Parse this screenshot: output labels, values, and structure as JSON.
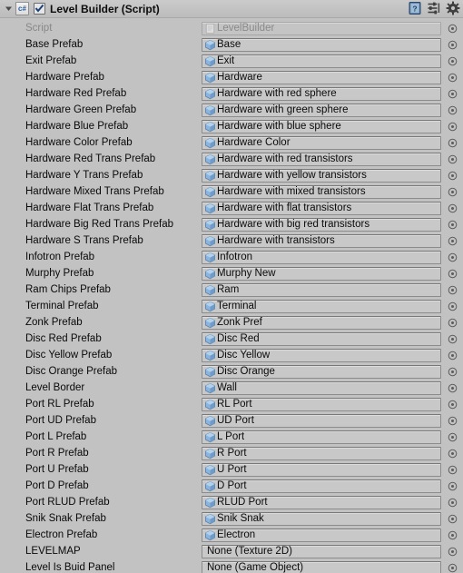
{
  "header": {
    "title": "Level Builder (Script)",
    "script_icon_label": "c#",
    "enabled": true,
    "icons": [
      "help-icon",
      "preset-icon",
      "settings-gear-icon"
    ]
  },
  "colors": {
    "background": "#c2c2c2",
    "field_background": "#c8c8c8",
    "field_border": "#8b8b8b",
    "label_text": "#090909",
    "disabled_text": "#888888",
    "prefab_icon": "#7ba7d7",
    "header_gradient_top": "#cbcbcb"
  },
  "rows": [
    {
      "label": "Script",
      "value": "LevelBuilder",
      "icon": "script-asset-icon",
      "disabled": true
    },
    {
      "label": "Base Prefab",
      "value": "Base",
      "icon": "prefab-icon",
      "disabled": false
    },
    {
      "label": "Exit Prefab",
      "value": "Exit",
      "icon": "prefab-icon",
      "disabled": false
    },
    {
      "label": "Hardware Prefab",
      "value": "Hardware",
      "icon": "prefab-icon",
      "disabled": false
    },
    {
      "label": "Hardware Red Prefab",
      "value": "Hardware with red sphere",
      "icon": "prefab-icon",
      "disabled": false
    },
    {
      "label": "Hardware Green Prefab",
      "value": "Hardware with green sphere",
      "icon": "prefab-icon",
      "disabled": false
    },
    {
      "label": "Hardware Blue Prefab",
      "value": "Hardware with blue sphere",
      "icon": "prefab-icon",
      "disabled": false
    },
    {
      "label": "Hardware Color Prefab",
      "value": "Hardware Color",
      "icon": "prefab-icon",
      "disabled": false
    },
    {
      "label": "Hardware Red Trans Prefab",
      "value": "Hardware with red transistors",
      "icon": "prefab-icon",
      "disabled": false
    },
    {
      "label": "Hardware Y Trans Prefab",
      "value": "Hardware with yellow transistors",
      "icon": "prefab-icon",
      "disabled": false
    },
    {
      "label": "Hardware Mixed Trans Prefab",
      "value": "Hardware with mixed transistors",
      "icon": "prefab-icon",
      "disabled": false
    },
    {
      "label": "Hardware Flat Trans Prefab",
      "value": "Hardware with flat transistors",
      "icon": "prefab-icon",
      "disabled": false
    },
    {
      "label": "Hardware Big Red Trans Prefab",
      "value": "Hardware with big red transistors",
      "icon": "prefab-icon",
      "disabled": false
    },
    {
      "label": "Hardware S Trans Prefab",
      "value": "Hardware with transistors",
      "icon": "prefab-icon",
      "disabled": false
    },
    {
      "label": "Infotron Prefab",
      "value": "Infotron",
      "icon": "prefab-icon",
      "disabled": false
    },
    {
      "label": "Murphy Prefab",
      "value": "Murphy New",
      "icon": "prefab-icon",
      "disabled": false
    },
    {
      "label": "Ram Chips Prefab",
      "value": "Ram",
      "icon": "prefab-icon",
      "disabled": false
    },
    {
      "label": "Terminal Prefab",
      "value": "Terminal",
      "icon": "prefab-icon",
      "disabled": false
    },
    {
      "label": "Zonk Prefab",
      "value": "Zonk Pref",
      "icon": "prefab-icon",
      "disabled": false
    },
    {
      "label": "Disc Red Prefab",
      "value": "Disc Red",
      "icon": "prefab-icon",
      "disabled": false
    },
    {
      "label": "Disc Yellow Prefab",
      "value": "Disc Yellow",
      "icon": "prefab-icon",
      "disabled": false
    },
    {
      "label": "Disc Orange Prefab",
      "value": "Disc Orange",
      "icon": "prefab-icon",
      "disabled": false
    },
    {
      "label": "Level Border",
      "value": "Wall",
      "icon": "prefab-icon",
      "disabled": false
    },
    {
      "label": "Port RL Prefab",
      "value": "RL Port",
      "icon": "prefab-icon",
      "disabled": false
    },
    {
      "label": "Port UD Prefab",
      "value": "UD Port",
      "icon": "prefab-icon",
      "disabled": false
    },
    {
      "label": "Port L Prefab",
      "value": "L Port",
      "icon": "prefab-icon",
      "disabled": false
    },
    {
      "label": "Port R Prefab",
      "value": "R Port",
      "icon": "prefab-icon",
      "disabled": false
    },
    {
      "label": "Port U Prefab",
      "value": "U Port",
      "icon": "prefab-icon",
      "disabled": false
    },
    {
      "label": "Port D Prefab",
      "value": "D Port",
      "icon": "prefab-icon",
      "disabled": false
    },
    {
      "label": "Port RLUD Prefab",
      "value": "RLUD Port",
      "icon": "prefab-icon",
      "disabled": false
    },
    {
      "label": "Snik Snak Prefab",
      "value": "Snik Snak",
      "icon": "prefab-icon",
      "disabled": false
    },
    {
      "label": "Electron Prefab",
      "value": "Electron",
      "icon": "prefab-icon",
      "disabled": false
    },
    {
      "label": "LEVELMAP",
      "value": "None (Texture 2D)",
      "icon": "none",
      "disabled": false
    },
    {
      "label": "Level Is Buid Panel",
      "value": "None (Game Object)",
      "icon": "none",
      "disabled": false
    }
  ]
}
